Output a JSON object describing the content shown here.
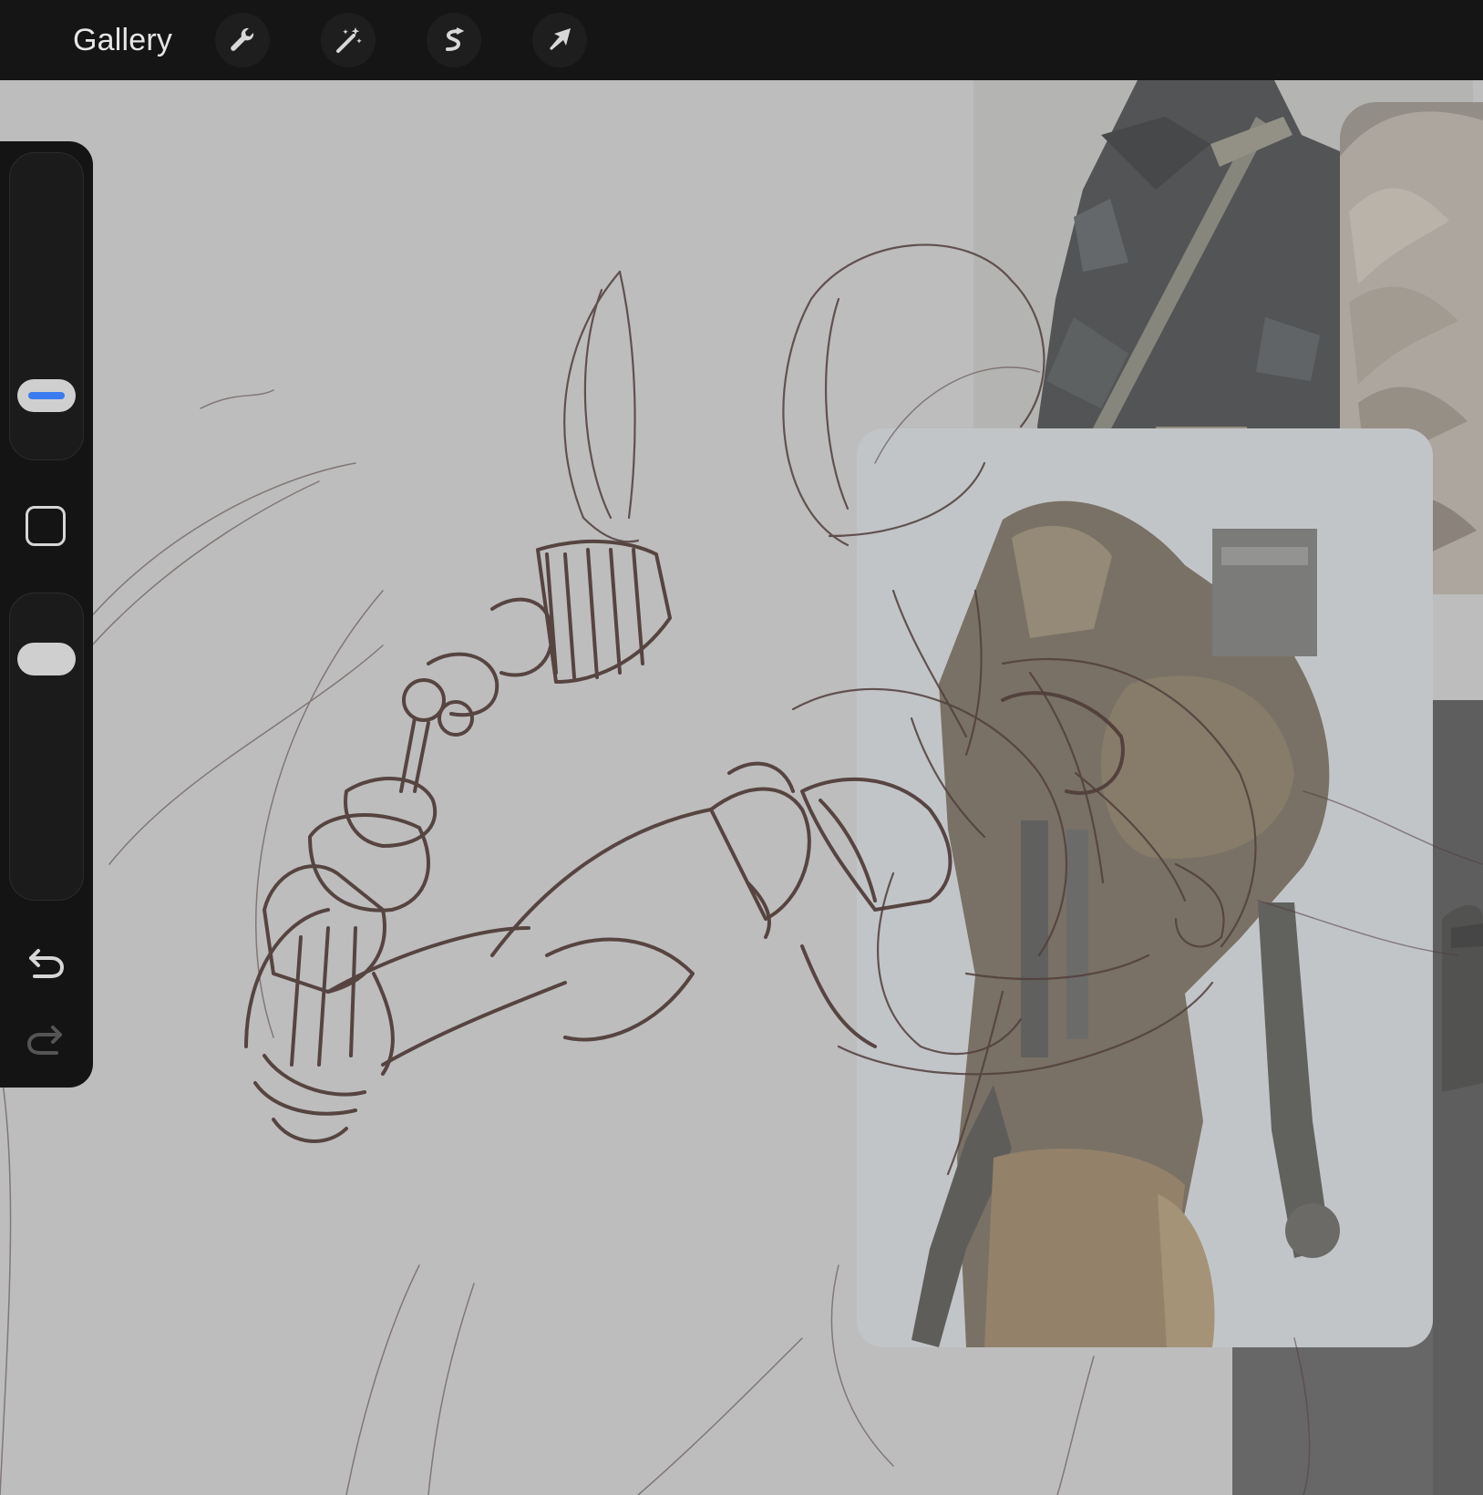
{
  "topbar": {
    "gallery_label": "Gallery",
    "tools": [
      {
        "name": "actions",
        "icon": "wrench-icon"
      },
      {
        "name": "adjustments",
        "icon": "magic-wand-icon"
      },
      {
        "name": "selection",
        "icon": "selection-s-icon"
      },
      {
        "name": "transform",
        "icon": "arrow-cursor-icon"
      }
    ]
  },
  "sidebar": {
    "brush_size_icon": "size-slider",
    "modify_icon": "square-outline-icon",
    "opacity_icon": "opacity-slider",
    "undo_icon": "undo-icon",
    "redo_icon": "redo-icon"
  },
  "colors": {
    "toolbar_bg": "#151515",
    "canvas_bg": "#bdbdbd",
    "sketch_stroke": "#3a2320",
    "slider_accent": "#3a7bf0"
  }
}
